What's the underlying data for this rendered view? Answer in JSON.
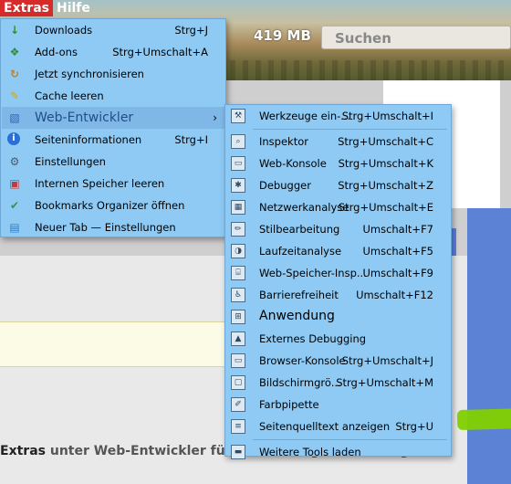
{
  "menubar": {
    "items": [
      "Extras",
      "Hilfe"
    ]
  },
  "toolbar": {
    "memory": "419 MB",
    "search_placeholder": "Suchen"
  },
  "instruction": {
    "strong": "Extras",
    "rest": " unter Web-Entwickler für den Eintrag Anwendung."
  },
  "extras_menu": [
    {
      "label": "Downloads",
      "shortcut": "Strg+J",
      "icon": "download-icon",
      "glyph": "↓"
    },
    {
      "label": "Add-ons",
      "shortcut": "Strg+Umschalt+A",
      "icon": "puzzle-icon",
      "glyph": "❖"
    },
    {
      "label": "Jetzt synchronisieren",
      "shortcut": "",
      "icon": "sync-icon",
      "glyph": "↻"
    },
    {
      "label": "Cache leeren",
      "shortcut": "",
      "icon": "broom-icon",
      "glyph": "✎"
    },
    {
      "label": "Web-Entwickler",
      "shortcut": "",
      "icon": "developer-icon",
      "glyph": "▧",
      "submenu": true
    },
    {
      "label": "Seiteninformationen",
      "shortcut": "Strg+I",
      "icon": "info-icon",
      "glyph": "i"
    },
    {
      "label": "Einstellungen",
      "shortcut": "",
      "icon": "gear-icon",
      "glyph": "⚙"
    },
    {
      "label": "Internen Speicher leeren",
      "shortcut": "",
      "icon": "storage-icon",
      "glyph": "▣"
    },
    {
      "label": "Bookmarks Organizer öffnen",
      "shortcut": "",
      "icon": "bookmark-icon",
      "glyph": "✔"
    },
    {
      "label": "Neuer Tab — Einstellungen",
      "shortcut": "",
      "icon": "new-tab-icon",
      "glyph": "▤"
    }
  ],
  "webdev_menu": [
    {
      "label": "Werkzeuge ein-...",
      "shortcut": "Strg+Umschalt+I",
      "icon": "toolbox-icon",
      "glyph": "⚒"
    },
    {
      "sep": true
    },
    {
      "label": "Inspektor",
      "shortcut": "Strg+Umschalt+C",
      "icon": "inspector-icon",
      "glyph": "⌕"
    },
    {
      "label": "Web-Konsole",
      "shortcut": "Strg+Umschalt+K",
      "icon": "console-icon",
      "glyph": "▭"
    },
    {
      "label": "Debugger",
      "shortcut": "Strg+Umschalt+Z",
      "icon": "debugger-icon",
      "glyph": "✱"
    },
    {
      "label": "Netzwerkanalyse",
      "shortcut": "Strg+Umschalt+E",
      "icon": "network-icon",
      "glyph": "▦"
    },
    {
      "label": "Stilbearbeitung",
      "shortcut": "Umschalt+F7",
      "icon": "style-editor-icon",
      "glyph": "✏"
    },
    {
      "label": "Laufzeitanalyse",
      "shortcut": "Umschalt+F5",
      "icon": "performance-icon",
      "glyph": "◑"
    },
    {
      "label": "Web-Speicher-Insp...",
      "shortcut": "Umschalt+F9",
      "icon": "storage-inspector-icon",
      "glyph": "⌸"
    },
    {
      "label": "Barrierefreiheit",
      "shortcut": "Umschalt+F12",
      "icon": "accessibility-icon",
      "glyph": "♿"
    },
    {
      "label": "Anwendung",
      "shortcut": "",
      "icon": "application-icon",
      "glyph": "⊞",
      "highlight": true
    },
    {
      "label": "Externes Debugging",
      "shortcut": "",
      "icon": "remote-debug-icon",
      "glyph": "▲"
    },
    {
      "label": "Browser-Konsole",
      "shortcut": "Strg+Umschalt+J",
      "icon": "browser-console-icon",
      "glyph": "▭"
    },
    {
      "label": "Bildschirmgrö...",
      "shortcut": "Strg+Umschalt+M",
      "icon": "responsive-icon",
      "glyph": "▢"
    },
    {
      "label": "Farbpipette",
      "shortcut": "",
      "icon": "eyedropper-icon",
      "glyph": "✐"
    },
    {
      "label": "Seitenquelltext anzeigen",
      "shortcut": "Strg+U",
      "icon": "page-source-icon",
      "glyph": "≡"
    },
    {
      "sep": true
    },
    {
      "label": "Weitere Tools laden",
      "shortcut": "",
      "icon": "toolbag-icon",
      "glyph": "▬"
    }
  ]
}
